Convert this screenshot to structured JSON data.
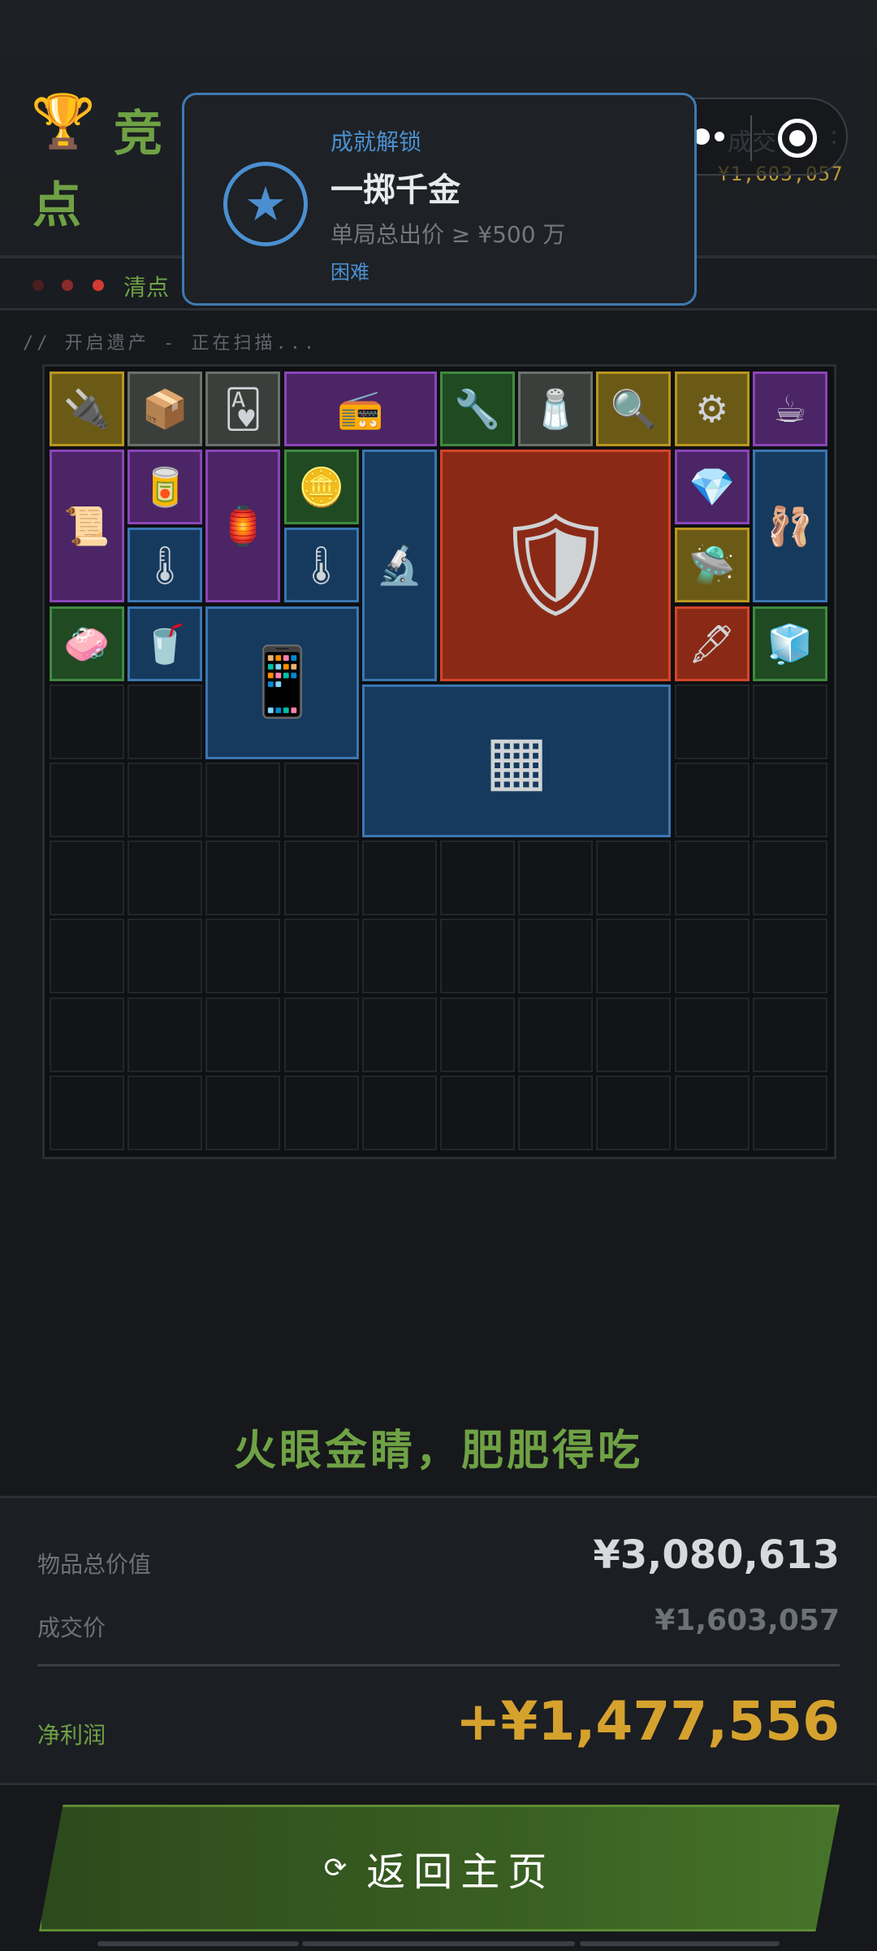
{
  "header": {
    "trophy_icon": "🏆",
    "title_partial": "竞",
    "title_line2": "点",
    "deal_label": "成交",
    "deal_colon": ":",
    "deal_value": "¥1,603,057"
  },
  "status": {
    "text": "清点",
    "scan_text": "// 开启遗产 - 正在扫描..."
  },
  "achievement": {
    "caption": "成就解锁",
    "name": "一掷千金",
    "description": "单局总出价 ≥ ¥500 万",
    "difficulty": "困难",
    "badge_icon": "star-icon",
    "accent": "#4b8fd0"
  },
  "grid": {
    "columns": 10,
    "rows": 10
  },
  "items": [
    {
      "name": "circuit-module",
      "rarity": "gold",
      "col": 0,
      "row": 0,
      "w": 1,
      "h": 1,
      "icon": "🔌"
    },
    {
      "name": "cash-box",
      "rarity": "gray",
      "col": 1,
      "row": 0,
      "w": 1,
      "h": 1,
      "icon": "📦"
    },
    {
      "name": "playing-card",
      "rarity": "gray",
      "col": 2,
      "row": 0,
      "w": 1,
      "h": 1,
      "icon": "🂱"
    },
    {
      "name": "radio",
      "rarity": "purple",
      "col": 3,
      "row": 0,
      "w": 2,
      "h": 1,
      "icon": "📻"
    },
    {
      "name": "pliers",
      "rarity": "green",
      "col": 5,
      "row": 0,
      "w": 1,
      "h": 1,
      "icon": "🔧"
    },
    {
      "name": "pepper-grinder",
      "rarity": "gray",
      "col": 6,
      "row": 0,
      "w": 1,
      "h": 1,
      "icon": "🧂"
    },
    {
      "name": "camera-lens",
      "rarity": "gold",
      "col": 7,
      "row": 0,
      "w": 1,
      "h": 1,
      "icon": "🔍"
    },
    {
      "name": "companion-cube",
      "rarity": "gold",
      "col": 8,
      "row": 0,
      "w": 1,
      "h": 1,
      "icon": "⚙"
    },
    {
      "name": "teacup",
      "rarity": "purple",
      "col": 9,
      "row": 0,
      "w": 1,
      "h": 1,
      "icon": "☕"
    },
    {
      "name": "old-book",
      "rarity": "purple",
      "col": 0,
      "row": 1,
      "w": 1,
      "h": 2,
      "icon": "📜"
    },
    {
      "name": "drink-can",
      "rarity": "purple",
      "col": 1,
      "row": 1,
      "w": 1,
      "h": 1,
      "icon": "🥫"
    },
    {
      "name": "lantern",
      "rarity": "purple",
      "col": 2,
      "row": 1,
      "w": 1,
      "h": 2,
      "icon": "🏮"
    },
    {
      "name": "coin",
      "rarity": "green",
      "col": 3,
      "row": 1,
      "w": 1,
      "h": 1,
      "icon": "🪙"
    },
    {
      "name": "microscope",
      "rarity": "blue",
      "col": 4,
      "row": 1,
      "w": 1,
      "h": 3,
      "icon": "🔬"
    },
    {
      "name": "tank",
      "rarity": "red",
      "col": 5,
      "row": 1,
      "w": 3,
      "h": 3,
      "icon": "🛡"
    },
    {
      "name": "earring",
      "rarity": "purple",
      "col": 8,
      "row": 1,
      "w": 1,
      "h": 1,
      "icon": "💎"
    },
    {
      "name": "ballerina-statue",
      "rarity": "blue",
      "col": 9,
      "row": 1,
      "w": 1,
      "h": 2,
      "icon": "🩰"
    },
    {
      "name": "thermometer-gun",
      "rarity": "blue",
      "col": 1,
      "row": 2,
      "w": 1,
      "h": 1,
      "icon": "🌡"
    },
    {
      "name": "thermometer-gun",
      "rarity": "blue",
      "col": 3,
      "row": 2,
      "w": 1,
      "h": 1,
      "icon": "🌡"
    },
    {
      "name": "drone-part",
      "rarity": "gold",
      "col": 8,
      "row": 2,
      "w": 1,
      "h": 1,
      "icon": "🛸"
    },
    {
      "name": "soap-dish",
      "rarity": "green",
      "col": 0,
      "row": 3,
      "w": 1,
      "h": 1,
      "icon": "🧼"
    },
    {
      "name": "cola-can",
      "rarity": "blue",
      "col": 1,
      "row": 3,
      "w": 1,
      "h": 1,
      "icon": "🥤"
    },
    {
      "name": "tablet-screen",
      "rarity": "blue",
      "col": 2,
      "row": 3,
      "w": 2,
      "h": 2,
      "icon": "📱"
    },
    {
      "name": "fountain-pen",
      "rarity": "red",
      "col": 8,
      "row": 3,
      "w": 1,
      "h": 1,
      "icon": "🖋"
    },
    {
      "name": "cpu-cooler",
      "rarity": "green",
      "col": 9,
      "row": 3,
      "w": 1,
      "h": 1,
      "icon": "🧊"
    },
    {
      "name": "solar-panel",
      "rarity": "blue",
      "col": 4,
      "row": 4,
      "w": 4,
      "h": 2,
      "icon": "▦"
    }
  ],
  "summary": {
    "slogan": "火眼金睛，肥肥得吃",
    "total_label": "物品总价值",
    "total_value": "¥3,080,613",
    "deal_label": "成交价",
    "deal_value": "¥1,603,057",
    "profit_label": "净利润",
    "profit_value": "+¥1,477,556"
  },
  "actions": {
    "home_label": "返回主页",
    "home_icon": "refresh-icon"
  },
  "colors": {
    "accent_green": "#6fa145",
    "gold_text": "#d6a22e",
    "background": "#16181b"
  }
}
